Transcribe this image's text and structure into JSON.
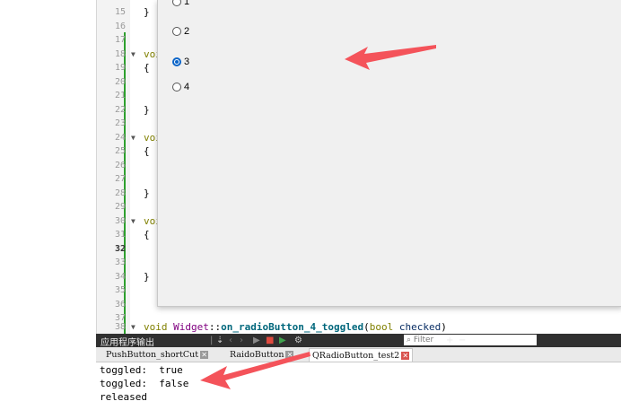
{
  "editor": {
    "lines": [
      {
        "num": "15",
        "text": "}"
      },
      {
        "num": "16",
        "text": ""
      },
      {
        "num": "17",
        "text": ""
      },
      {
        "num": "18",
        "text": "voi"
      },
      {
        "num": "19",
        "text": "{"
      },
      {
        "num": "20",
        "text": ""
      },
      {
        "num": "21",
        "text": ""
      },
      {
        "num": "22",
        "text": "}"
      },
      {
        "num": "23",
        "text": ""
      },
      {
        "num": "24",
        "text": "voi"
      },
      {
        "num": "25",
        "text": "{"
      },
      {
        "num": "26",
        "text": ""
      },
      {
        "num": "27",
        "text": ""
      },
      {
        "num": "28",
        "text": "}"
      },
      {
        "num": "29",
        "text": ""
      },
      {
        "num": "30",
        "text": "voi"
      },
      {
        "num": "31",
        "text": "{"
      },
      {
        "num": "32",
        "text": ""
      },
      {
        "num": "33",
        "text": ""
      },
      {
        "num": "34",
        "text": "}"
      },
      {
        "num": "35",
        "text": ""
      },
      {
        "num": "36",
        "text": ""
      },
      {
        "num": "37",
        "text": ""
      }
    ],
    "last_line": {
      "num": "38",
      "kw": "void",
      "cls": "Widget",
      "sep": "::",
      "fn": "on_radioButton_4_toggled",
      "open": "(",
      "type": "bool",
      "param": "checked",
      "close": ")"
    }
  },
  "dialog": {
    "radios": [
      {
        "label": "1",
        "checked": false
      },
      {
        "label": "2",
        "checked": false
      },
      {
        "label": "3",
        "checked": true
      },
      {
        "label": "4",
        "checked": false
      }
    ]
  },
  "output_panel": {
    "title": "应用程序输出",
    "filter_placeholder": "Filter",
    "add_label": "+",
    "minus_label": "−",
    "tabs": [
      "PushButton_shortCut",
      "RaidoButton",
      "QRadioButton_test2"
    ],
    "active_tab": 2,
    "lines": [
      "toggled:  true",
      "toggled:  false",
      "released"
    ]
  },
  "colors": {
    "accent_red_arrow": "#f4535a",
    "radio_checked": "#0a64c8",
    "panel_bar": "#303030"
  }
}
